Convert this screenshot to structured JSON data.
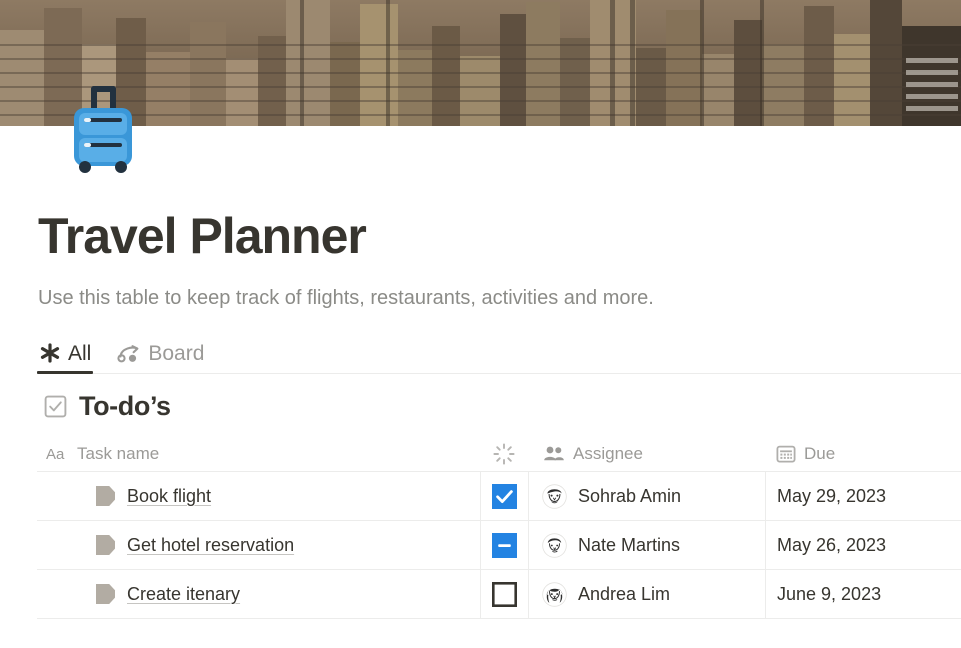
{
  "page": {
    "icon_name": "luggage-icon",
    "title": "Travel Planner",
    "subtitle": "Use this table to keep track of flights, restaurants, activities and more.",
    "cover_name": "city-skyline-cover"
  },
  "tabs": [
    {
      "label": "All",
      "icon": "asterisk-icon",
      "active": true
    },
    {
      "label": "Board",
      "icon": "board-arrow-icon",
      "active": false
    }
  ],
  "section": {
    "icon": "checkbox-checked-icon",
    "title": "To-do’s"
  },
  "table": {
    "columns": [
      {
        "label": "Task name",
        "icon": "aa-text-icon"
      },
      {
        "label": "",
        "icon": "spinner-icon"
      },
      {
        "label": "Assignee",
        "icon": "people-icon"
      },
      {
        "label": "Due",
        "icon": "calendar-icon"
      }
    ],
    "rows": [
      {
        "icon": "page-doc-icon",
        "task": "Book flight",
        "checkbox": "checked",
        "avatar": "avatar-sohrab",
        "assignee": "Sohrab Amin",
        "due": "May 29, 2023"
      },
      {
        "icon": "page-doc-icon",
        "task": "Get hotel reservation",
        "checkbox": "indeterminate",
        "avatar": "avatar-nate",
        "assignee": "Nate Martins",
        "due": "May 26, 2023"
      },
      {
        "icon": "page-doc-icon",
        "task": "Create itenary",
        "checkbox": "unchecked",
        "avatar": "avatar-andrea",
        "assignee": "Andrea Lim",
        "due": "June 9, 2023"
      }
    ]
  },
  "colors": {
    "accent_blue": "#2383e2",
    "text_primary": "#37352f",
    "text_muted": "#9b9a97",
    "border": "#ececeb"
  }
}
